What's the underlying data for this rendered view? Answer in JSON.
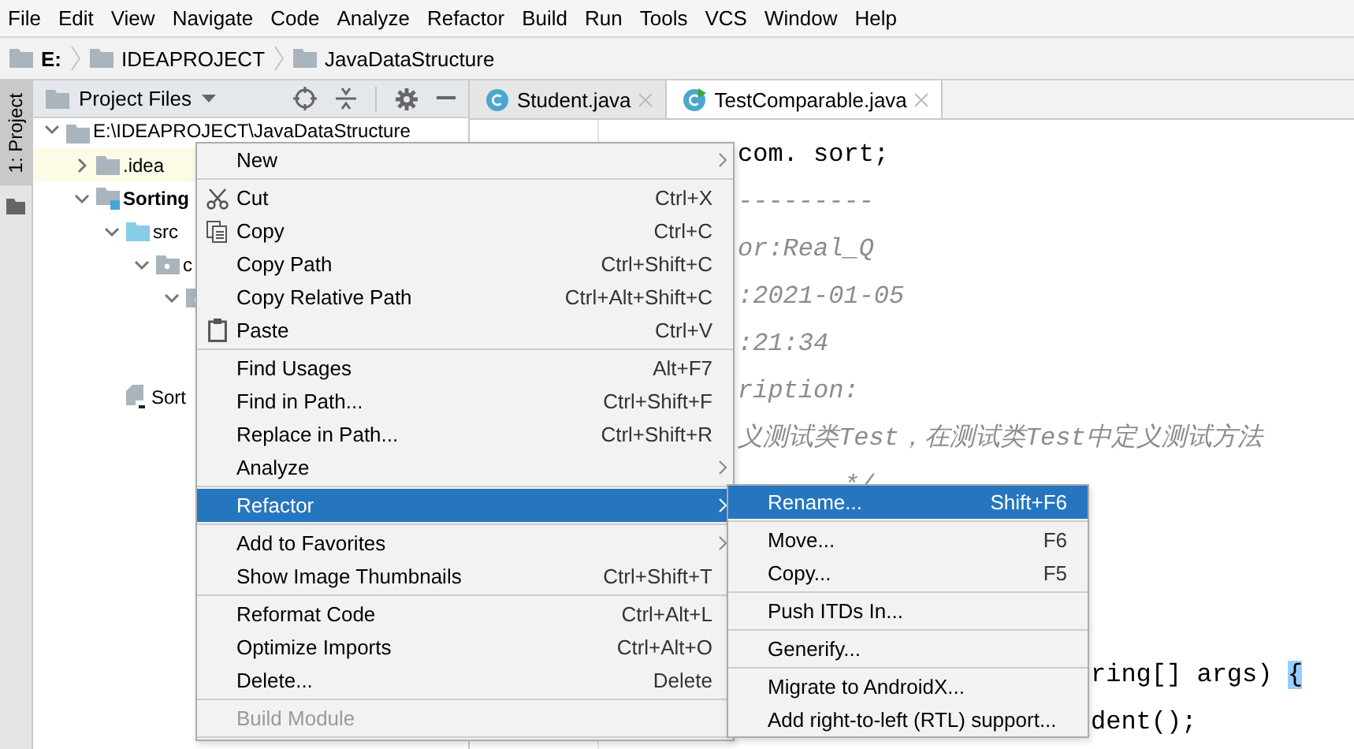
{
  "menubar": [
    {
      "label": "File"
    },
    {
      "label": "Edit"
    },
    {
      "label": "View"
    },
    {
      "label": "Navigate"
    },
    {
      "label": "Code"
    },
    {
      "label": "Analyze"
    },
    {
      "label": "Refactor"
    },
    {
      "label": "Build"
    },
    {
      "label": "Run"
    },
    {
      "label": "Tools"
    },
    {
      "label": "VCS"
    },
    {
      "label": "Window"
    },
    {
      "label": "Help"
    }
  ],
  "breadcrumbs": [
    {
      "label": "E:",
      "bold": true
    },
    {
      "label": "IDEAPROJECT",
      "bold": false
    },
    {
      "label": "JavaDataStructure",
      "bold": false
    }
  ],
  "tool_stripe": {
    "tab": {
      "label": "1: Project",
      "selected": true
    }
  },
  "project_panel": {
    "title": "Project Files",
    "tree": [
      {
        "label": "E:\\IDEAPROJECT\\JavaDataStructure",
        "kind": "folder",
        "expanded": true,
        "highlighted": false,
        "bold": false,
        "children": [
          {
            "label": ".idea",
            "kind": "folder",
            "expanded": false,
            "highlighted": true,
            "bold": false
          },
          {
            "label": "Sorting",
            "kind": "module",
            "expanded": true,
            "highlighted": false,
            "bold": true,
            "children": [
              {
                "label": "src",
                "kind": "source",
                "expanded": true,
                "highlighted": false,
                "bold": false,
                "children": [
                  {
                    "label": "c",
                    "kind": "package",
                    "expanded": true,
                    "highlighted": false,
                    "bold": false,
                    "children": [
                      {
                        "kind": "package",
                        "expanded": true,
                        "highlighted": false
                      }
                    ]
                  }
                ]
              },
              {
                "label": "Sort",
                "kind": "file",
                "highlighted": false,
                "bold": false
              }
            ]
          }
        ]
      }
    ]
  },
  "editor": {
    "tabs": [
      {
        "label": "Student.java",
        "selected": false
      },
      {
        "label": "TestComparable.java",
        "selected": true
      }
    ],
    "lines_right_of_menu": [
      {
        "kind": "code",
        "segments": [
          {
            "text": "com. sort;",
            "highlight": false
          }
        ]
      },
      {
        "kind": "comment",
        "segments": [
          {
            "text": "---------",
            "highlight": false
          }
        ]
      },
      {
        "kind": "comment",
        "segments": [
          {
            "text": "or:Real_Q",
            "highlight": false
          }
        ]
      },
      {
        "kind": "comment",
        "segments": [
          {
            "text": ":2021-01-05",
            "highlight": false
          }
        ]
      },
      {
        "kind": "comment",
        "segments": [
          {
            "text": ":21:34",
            "highlight": false
          }
        ]
      },
      {
        "kind": "comment",
        "segments": [
          {
            "text": "ription:",
            "highlight": false
          }
        ]
      },
      {
        "kind": "comment",
        "segments": [
          {
            "text": "义测试类Test，在测试类Test中定义测试方法",
            "highlight": false
          }
        ]
      },
      {
        "kind": "comment",
        "segments": [
          {
            "text": "       */",
            "highlight": false
          }
        ]
      }
    ],
    "lines_right_of_submenu": [
      {
        "segments": [
          {
            "text": "ring[] args) ",
            "highlight": false
          },
          {
            "text": "{",
            "highlight": true
          }
        ]
      },
      {
        "segments": [
          {
            "text": "dent();",
            "highlight": false
          }
        ]
      }
    ]
  },
  "context_menu": {
    "items": [
      {
        "kind": "item",
        "label": "New",
        "submenu": true,
        "selected": false,
        "disabled": false
      },
      {
        "kind": "separator"
      },
      {
        "kind": "cut",
        "label": "Cut",
        "shortcut": "Ctrl+X",
        "submenu": false,
        "selected": false,
        "disabled": false
      },
      {
        "kind": "copy",
        "label": "Copy",
        "shortcut": "Ctrl+C",
        "submenu": false,
        "selected": false,
        "disabled": false
      },
      {
        "kind": "item",
        "label": "Copy Path",
        "shortcut": "Ctrl+Shift+C",
        "submenu": false,
        "selected": false,
        "disabled": false
      },
      {
        "kind": "item",
        "label": "Copy Relative Path",
        "shortcut": "Ctrl+Alt+Shift+C",
        "submenu": false,
        "selected": false,
        "disabled": false
      },
      {
        "kind": "paste",
        "label": "Paste",
        "shortcut": "Ctrl+V",
        "submenu": false,
        "selected": false,
        "disabled": false
      },
      {
        "kind": "separator"
      },
      {
        "kind": "item",
        "label": "Find Usages",
        "shortcut": "Alt+F7",
        "submenu": false,
        "selected": false,
        "disabled": false
      },
      {
        "kind": "item",
        "label": "Find in Path...",
        "shortcut": "Ctrl+Shift+F",
        "submenu": false,
        "selected": false,
        "disabled": false
      },
      {
        "kind": "item",
        "label": "Replace in Path...",
        "shortcut": "Ctrl+Shift+R",
        "submenu": false,
        "selected": false,
        "disabled": false
      },
      {
        "kind": "item",
        "label": "Analyze",
        "submenu": true,
        "selected": false,
        "disabled": false
      },
      {
        "kind": "separator"
      },
      {
        "kind": "item",
        "label": "Refactor",
        "submenu": true,
        "selected": true,
        "disabled": false
      },
      {
        "kind": "separator"
      },
      {
        "kind": "item",
        "label": "Add to Favorites",
        "submenu": true,
        "selected": false,
        "disabled": false
      },
      {
        "kind": "item",
        "label": "Show Image Thumbnails",
        "shortcut": "Ctrl+Shift+T",
        "submenu": false,
        "selected": false,
        "disabled": false
      },
      {
        "kind": "separator"
      },
      {
        "kind": "item",
        "label": "Reformat Code",
        "shortcut": "Ctrl+Alt+L",
        "submenu": false,
        "selected": false,
        "disabled": false
      },
      {
        "kind": "item",
        "label": "Optimize Imports",
        "shortcut": "Ctrl+Alt+O",
        "submenu": false,
        "selected": false,
        "disabled": false
      },
      {
        "kind": "item",
        "label": "Delete...",
        "shortcut": "Delete",
        "submenu": false,
        "selected": false,
        "disabled": false
      },
      {
        "kind": "separator"
      },
      {
        "kind": "item",
        "label": "Build Module",
        "submenu": false,
        "selected": false,
        "disabled": true
      },
      {
        "kind": "separator"
      }
    ]
  },
  "submenu": {
    "items": [
      {
        "kind": "item",
        "label": "Rename...",
        "shortcut": "Shift+F6",
        "submenu": false,
        "selected": true,
        "disabled": false
      },
      {
        "kind": "separator"
      },
      {
        "kind": "item",
        "label": "Move...",
        "shortcut": "F6",
        "submenu": false,
        "selected": false,
        "disabled": false
      },
      {
        "kind": "item",
        "label": "Copy...",
        "shortcut": "F5",
        "submenu": false,
        "selected": false,
        "disabled": false
      },
      {
        "kind": "separator"
      },
      {
        "kind": "item",
        "label": "Push ITDs In...",
        "submenu": false,
        "selected": false,
        "disabled": false
      },
      {
        "kind": "separator"
      },
      {
        "kind": "item",
        "label": "Generify...",
        "submenu": false,
        "selected": false,
        "disabled": false
      },
      {
        "kind": "separator"
      },
      {
        "kind": "item",
        "label": "Migrate to AndroidX...",
        "submenu": false,
        "selected": false,
        "disabled": false
      },
      {
        "kind": "item",
        "label": "Add right-to-left (RTL) support...",
        "submenu": false,
        "selected": false,
        "disabled": false
      }
    ]
  }
}
